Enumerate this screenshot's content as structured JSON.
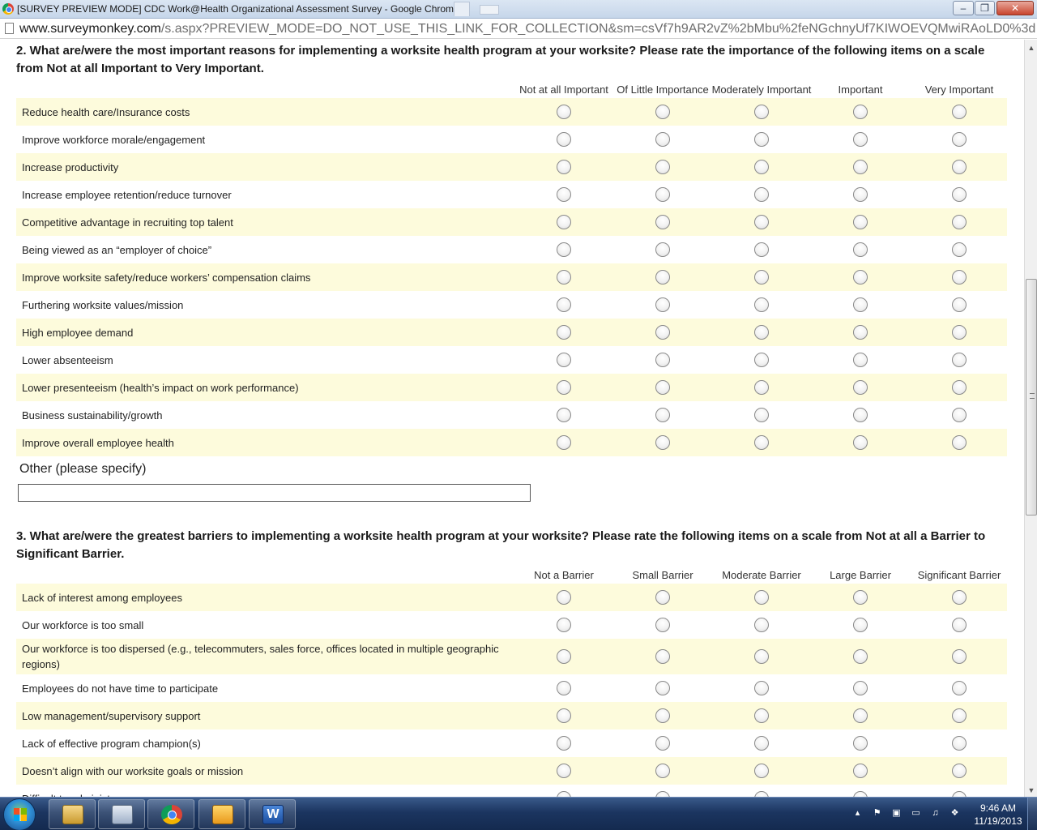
{
  "window": {
    "title": "[SURVEY PREVIEW MODE] CDC Work@Health Organizational Assessment Survey - Google Chrome",
    "minimize_glyph": "–",
    "maximize_glyph": "❐",
    "close_glyph": "✕"
  },
  "addressbar": {
    "host": "www.surveymonkey.com",
    "path": "/s.aspx?PREVIEW_MODE=DO_NOT_USE_THIS_LINK_FOR_COLLECTION&sm=csVf7h9AR2vZ%2bMbu%2feNGchnyUf7KIWOEVQMwiRAoLD0%3d"
  },
  "questions": [
    {
      "text": "2. What are/were the most important reasons for implementing a worksite health program at your worksite? Please rate the importance of the following items on a scale from Not at all Important to Very Important.",
      "columns": [
        "Not at all Important",
        "Of Little Importance",
        "Moderately Important",
        "Important",
        "Very Important"
      ],
      "rows": [
        "Reduce health care/Insurance costs",
        "Improve workforce morale/engagement",
        "Increase productivity",
        "Increase employee retention/reduce turnover",
        "Competitive advantage in recruiting top talent",
        "Being viewed as an “employer of choice”",
        "Improve worksite safety/reduce workers’ compensation claims",
        "Furthering worksite values/mission",
        "High employee demand",
        "Lower absenteeism",
        "Lower presenteeism (health’s impact on work performance)",
        "Business sustainability/growth",
        "Improve overall employee health"
      ],
      "other_label": "Other (please specify)",
      "other_value": ""
    },
    {
      "text": "3. What are/were the greatest barriers to implementing a worksite health program at your worksite? Please rate the following items on a scale from Not at all a Barrier to Significant Barrier.",
      "columns": [
        "Not a Barrier",
        "Small Barrier",
        "Moderate Barrier",
        "Large Barrier",
        "Significant Barrier"
      ],
      "rows": [
        "Lack of interest among employees",
        "Our workforce is too small",
        "Our workforce is too dispersed (e.g., telecommuters, sales force, offices located in multiple geographic regions)",
        "Employees do not have time to participate",
        "Low management/supervisory support",
        "Lack of effective program champion(s)",
        "Doesn’t align with our worksite goals or mission",
        "Difficult to administer"
      ]
    }
  ],
  "scrollbar": {
    "up_glyph": "▲",
    "down_glyph": "▼"
  },
  "taskbar": {
    "apps": [
      "explorer-icon",
      "calculator-icon",
      "chrome-icon",
      "outlook-icon",
      "word-icon"
    ],
    "word_glyph": "W",
    "tray_glyphs": [
      "▴",
      "⚑",
      "▣",
      "▭",
      "♫",
      "❖"
    ],
    "time": "9:46 AM",
    "date": "11/19/2013"
  },
  "colors": {
    "row_shade": "#fdfbdc",
    "taskbar": "#1b3560"
  }
}
